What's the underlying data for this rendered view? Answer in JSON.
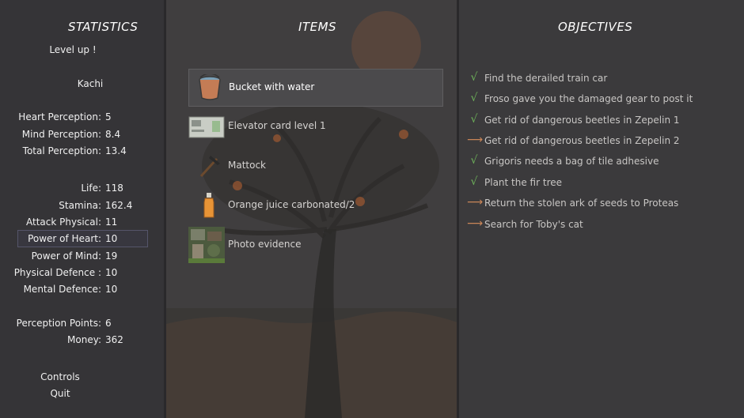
{
  "statistics": {
    "title": "STATISTICS",
    "level_up": "Level up !",
    "name": "Kachi",
    "perception": [
      {
        "label": "Heart Perception:",
        "value": "5"
      },
      {
        "label": "Mind Perception:",
        "value": "8.4"
      },
      {
        "label": "Total Perception:",
        "value": "13.4"
      }
    ],
    "attributes": [
      {
        "label": "Life:",
        "value": "118"
      },
      {
        "label": "Stamina:",
        "value": "162.4"
      },
      {
        "label": "Attack Physical:",
        "value": "11"
      },
      {
        "label": "Power of Heart:",
        "value": "10"
      },
      {
        "label": "Power of Mind:",
        "value": "19"
      },
      {
        "label": "Physical Defence :",
        "value": "10"
      },
      {
        "label": "Mental Defence:",
        "value": "10"
      }
    ],
    "extra": [
      {
        "label": "Perception Points:",
        "value": "6"
      },
      {
        "label": "Money:",
        "value": "362"
      }
    ],
    "menu": {
      "controls": "Controls",
      "quit": "Quit"
    }
  },
  "items": {
    "title": "ITEMS",
    "list": [
      {
        "label": "Bucket with water",
        "icon": "bucket-icon"
      },
      {
        "label": "Elevator card level 1",
        "icon": "card-icon"
      },
      {
        "label": "Mattock",
        "icon": "mattock-icon"
      },
      {
        "label": "Orange juice carbonated/2",
        "icon": "bottle-icon"
      },
      {
        "label": "Photo evidence",
        "icon": "photo-icon"
      }
    ],
    "selected_index": 0
  },
  "objectives": {
    "title": "OBJECTIVES",
    "list": [
      {
        "text": "Find the derailed train car",
        "status": "done"
      },
      {
        "text": "Froso gave you the damaged gear to post it",
        "status": "done"
      },
      {
        "text": "Get rid of dangerous beetles in Zepelin 1",
        "status": "done"
      },
      {
        "text": "Get rid of dangerous beetles in Zepelin 2",
        "status": "active"
      },
      {
        "text": "Grigoris needs a bag of tile adhesive",
        "status": "done"
      },
      {
        "text": "Plant the fir tree",
        "status": "done"
      },
      {
        "text": "Return the stolen ark of seeds to Proteas",
        "status": "active"
      },
      {
        "text": "Search for Toby's cat",
        "status": "active"
      }
    ]
  },
  "colors": {
    "done": "#6db05a",
    "active": "#c98558"
  }
}
